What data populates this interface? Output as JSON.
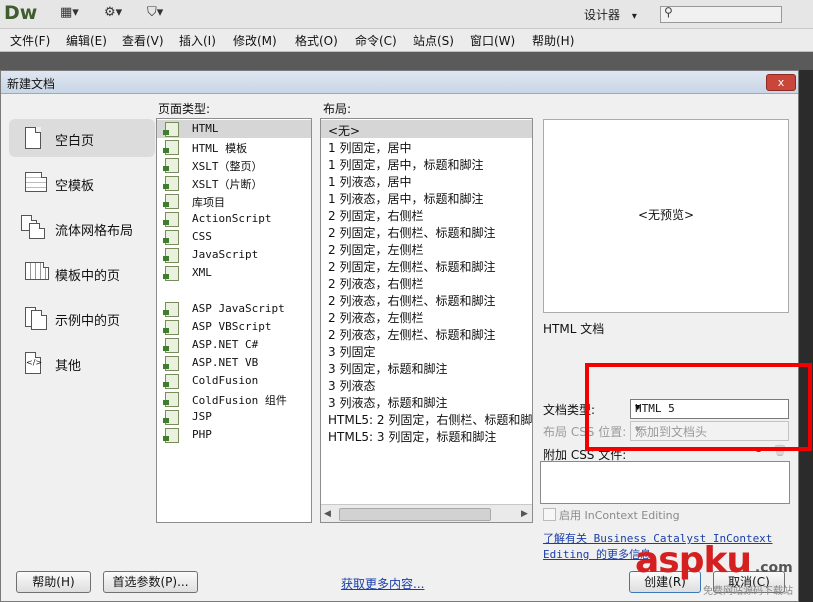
{
  "app": {
    "logo": "Dw",
    "toolbar_icons": [
      "▦▾",
      "⚙▾",
      "⛉▾"
    ],
    "workspace_label": "设计器",
    "workspace_arrow": "▾",
    "search_icon": "⚲"
  },
  "menu": [
    "文件(F)",
    "编辑(E)",
    "查看(V)",
    "插入(I)",
    "修改(M)",
    "格式(O)",
    "命令(C)",
    "站点(S)",
    "窗口(W)",
    "帮助(H)"
  ],
  "dialog": {
    "title": "新建文档",
    "close": "x",
    "categories": [
      {
        "label": "空白页",
        "icon": "blank-page-icon"
      },
      {
        "label": "空模板",
        "icon": "blank-template-icon"
      },
      {
        "label": "流体网格布局",
        "icon": "fluid-grid-icon"
      },
      {
        "label": "模板中的页",
        "icon": "template-page-icon"
      },
      {
        "label": "示例中的页",
        "icon": "sample-page-icon"
      },
      {
        "label": "其他",
        "icon": "other-code-icon"
      }
    ],
    "page_type_label": "页面类型:",
    "page_types": [
      "HTML",
      "HTML 模板",
      "XSLT（整页）",
      "XSLT（片断）",
      "库项目",
      "ActionScript",
      "CSS",
      "JavaScript",
      "XML",
      "",
      "ASP JavaScript",
      "ASP VBScript",
      "ASP.NET C#",
      "ASP.NET VB",
      "ColdFusion",
      "ColdFusion 组件",
      "JSP",
      "PHP"
    ],
    "layout_label": "布局:",
    "layouts": [
      "<无>",
      "1 列固定，居中",
      "1 列固定，居中，标题和脚注",
      "1 列液态，居中",
      "1 列液态，居中，标题和脚注",
      "2 列固定，右侧栏",
      "2 列固定，右侧栏、标题和脚注",
      "2 列固定，左侧栏",
      "2 列固定，左侧栏、标题和脚注",
      "2 列液态，右侧栏",
      "2 列液态，右侧栏、标题和脚注",
      "2 列液态，左侧栏",
      "2 列液态，左侧栏、标题和脚注",
      "3 列固定",
      "3 列固定，标题和脚注",
      "3 列液态",
      "3 列液态，标题和脚注",
      "HTML5: 2 列固定，右侧栏、标题和脚注",
      "HTML5: 3 列固定，标题和脚注"
    ],
    "preview_text": "<无预览>",
    "description": "HTML 文档",
    "doctype_label": "文档类型:",
    "doctype_value": "HTML 5",
    "layout_css_label": "布局 CSS 位置:",
    "layout_css_value": "添加到文档头",
    "attach_css_label": "附加 CSS 文件:",
    "incontext_label": "启用 InContext Editing",
    "learn_more_line1": "了解有关 Business Catalyst InContext",
    "learn_more_line2": "Editing 的更多信息",
    "get_more": "获取更多内容...",
    "help_button": "帮助(H)",
    "prefs_button": "首选参数(P)...",
    "create_button": "创建(R)",
    "cancel_button": "取消(C)"
  },
  "watermark": {
    "main": "aspku",
    "tld": ".com",
    "sub": "免费网站源码下载站"
  }
}
